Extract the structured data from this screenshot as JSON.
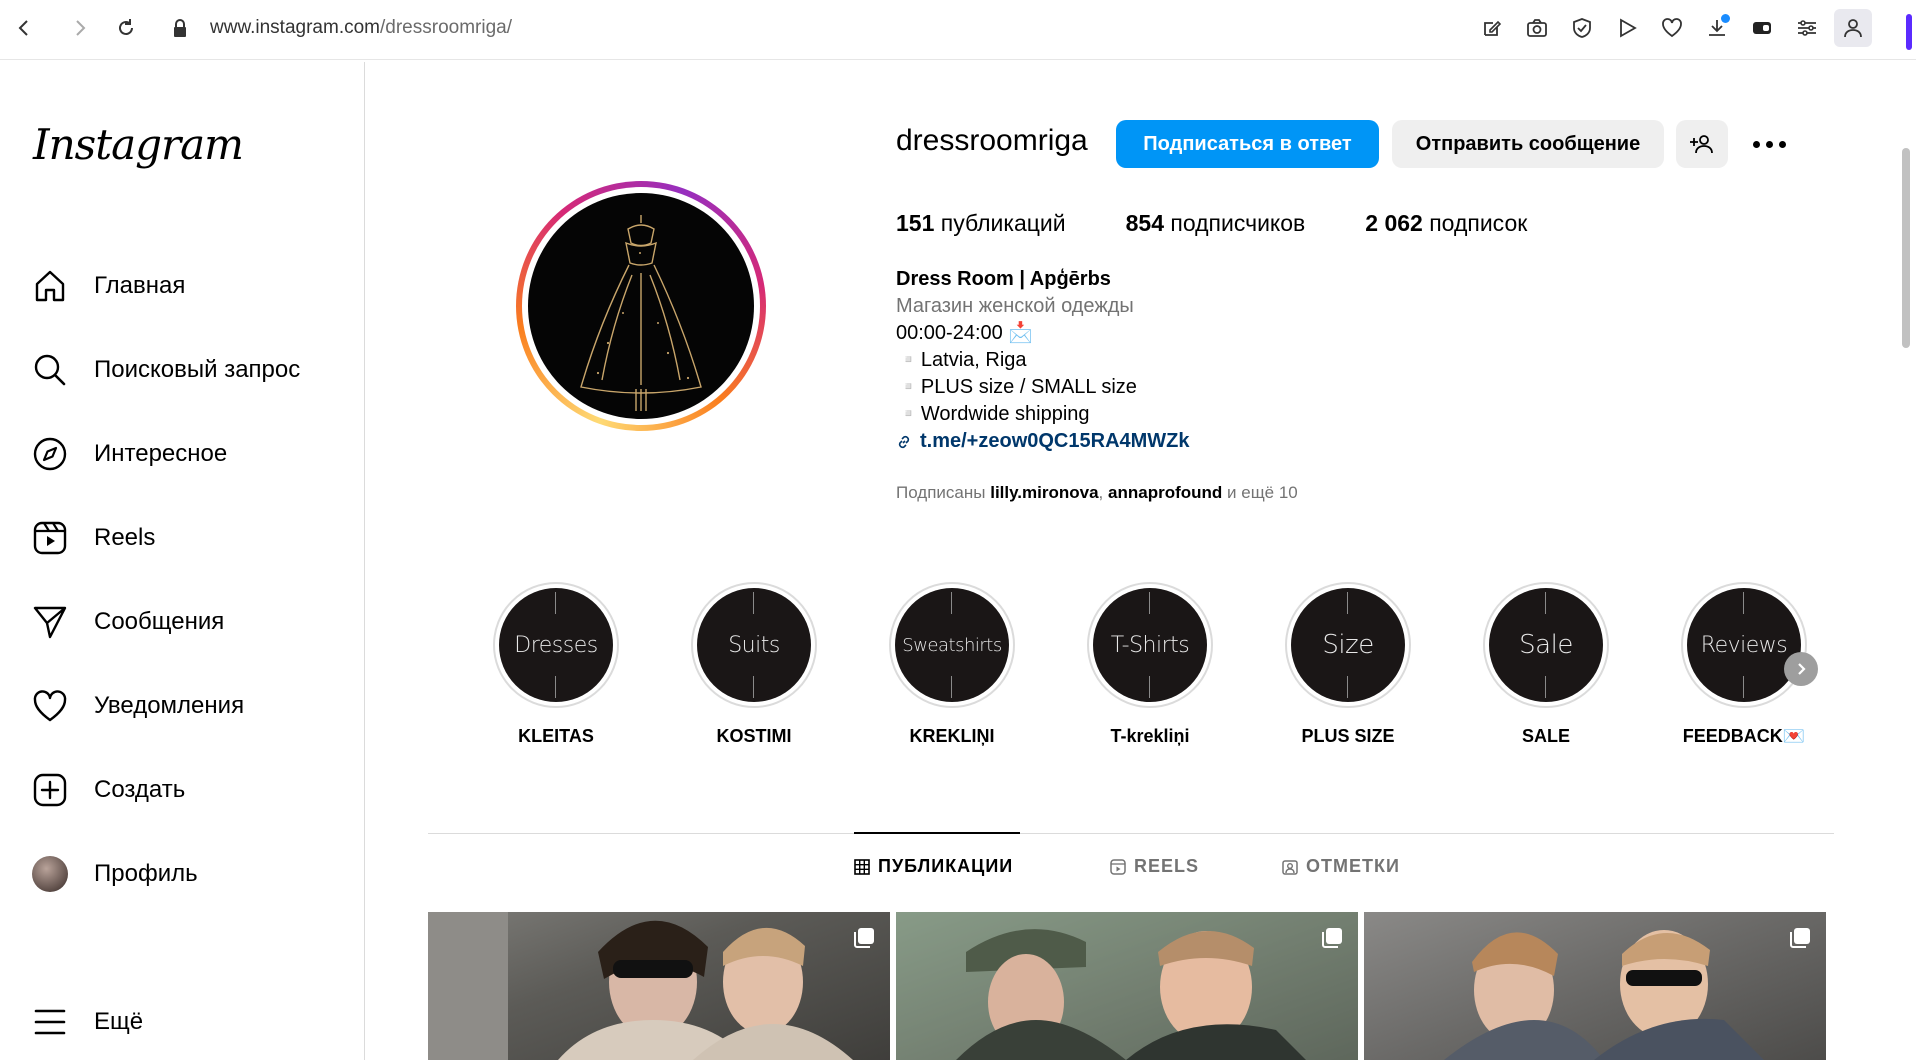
{
  "browser": {
    "url_host": "www.instagram.com",
    "url_path": "/dressroomriga/"
  },
  "sidebar": {
    "logo": "Instagram",
    "items": [
      {
        "label": "Главная",
        "icon": "home-icon"
      },
      {
        "label": "Поисковый запрос",
        "icon": "search-icon"
      },
      {
        "label": "Интересное",
        "icon": "compass-icon"
      },
      {
        "label": "Reels",
        "icon": "reels-icon"
      },
      {
        "label": "Сообщения",
        "icon": "messages-icon"
      },
      {
        "label": "Уведомления",
        "icon": "heart-icon"
      },
      {
        "label": "Создать",
        "icon": "plus-icon"
      },
      {
        "label": "Профиль",
        "icon": "avatar"
      }
    ],
    "more_label": "Ещё"
  },
  "profile": {
    "username": "dressroomriga",
    "follow_back_label": "Подписаться в ответ",
    "message_label": "Отправить сообщение",
    "stats": {
      "posts_count": "151",
      "posts_label": "публикаций",
      "followers_count": "854",
      "followers_label": "подписчиков",
      "following_count": "2 062",
      "following_label": "подписок"
    },
    "bio": {
      "name": "Dress Room | Apģērbs",
      "category": "Магазин женской одежды",
      "hours": "00:00-24:00 📩",
      "line1": "▫️Latvia, Riga",
      "line2": "▫️PLUS size / SMALL size",
      "line3": "▫️Wordwide shipping",
      "link": "t.me/+zeow0QC15RA4MWZk"
    },
    "followed_by": {
      "prefix": "Подписаны",
      "user1": "lilly.mironova",
      "sep": ",",
      "user2": "annaprofound",
      "suffix": "и ещё 10"
    }
  },
  "highlights": [
    {
      "cover": "Dresses",
      "label": "KLEITAS"
    },
    {
      "cover": "Suits",
      "label": "KOSTIMI"
    },
    {
      "cover": "Sweatshirts",
      "label": "KREKLIŅI"
    },
    {
      "cover": "T-Shirts",
      "label": "T-krekliņi"
    },
    {
      "cover": "Size",
      "label": "PLUS SIZE"
    },
    {
      "cover": "Sale",
      "label": "SALE"
    },
    {
      "cover": "Reviews",
      "label": "FEEDBACK💌"
    }
  ],
  "tabs": [
    {
      "label": "ПУБЛИКАЦИИ",
      "active": true
    },
    {
      "label": "REELS",
      "active": false
    },
    {
      "label": "ОТМЕТКИ",
      "active": false
    }
  ],
  "colors": {
    "primary_button": "#0095f6",
    "link": "#00376b",
    "secondary_text": "#737373"
  }
}
